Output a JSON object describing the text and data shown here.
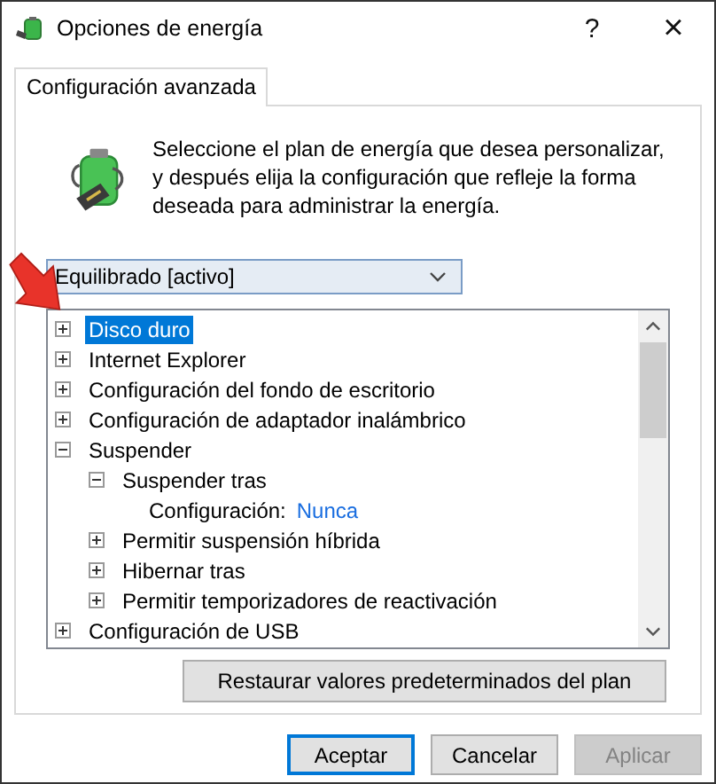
{
  "window": {
    "title": "Opciones de energía",
    "help": "?",
    "close": "×"
  },
  "tabs": [
    {
      "label": "Configuración avanzada",
      "selected": true
    }
  ],
  "intro": "Seleccione el plan de energía que desea personalizar, y después elija la configuración que refleje la forma deseada para administrar la energía.",
  "plan_select": {
    "value": "Equilibrado [activo]"
  },
  "tree": {
    "items": [
      {
        "kind": "group",
        "label": "Disco duro",
        "expanded": false,
        "selected": true
      },
      {
        "kind": "group",
        "label": "Internet Explorer",
        "expanded": false,
        "selected": false
      },
      {
        "kind": "group",
        "label": "Configuración del fondo de escritorio",
        "expanded": false,
        "selected": false
      },
      {
        "kind": "group",
        "label": "Configuración de adaptador inalámbrico",
        "expanded": false,
        "selected": false
      },
      {
        "kind": "group",
        "label": "Suspender",
        "expanded": true,
        "selected": false,
        "children": [
          {
            "kind": "group",
            "label": "Suspender tras",
            "expanded": true,
            "selected": false,
            "children": [
              {
                "kind": "setting",
                "label": "Configuración:",
                "value": "Nunca",
                "selected": false
              }
            ]
          },
          {
            "kind": "group",
            "label": "Permitir suspensión híbrida",
            "expanded": false,
            "selected": false
          },
          {
            "kind": "group",
            "label": "Hibernar tras",
            "expanded": false,
            "selected": false
          },
          {
            "kind": "group",
            "label": "Permitir temporizadores de reactivación",
            "expanded": false,
            "selected": false
          }
        ]
      },
      {
        "kind": "group",
        "label": "Configuración de USB",
        "expanded": false,
        "selected": false
      }
    ]
  },
  "restore_button": "Restaurar valores predeterminados del plan",
  "buttons": [
    {
      "label": "Aceptar",
      "default": true,
      "disabled": false
    },
    {
      "label": "Cancelar",
      "default": false,
      "disabled": false
    },
    {
      "label": "Aplicar",
      "default": false,
      "disabled": true
    }
  ]
}
